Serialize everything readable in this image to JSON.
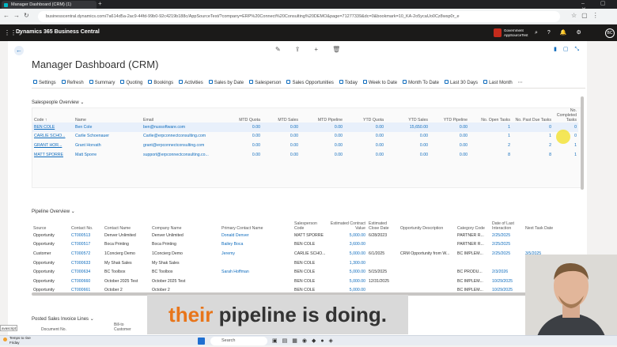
{
  "browser": {
    "tab_title": "Manager Dashboard (CRM) (1)",
    "url": "businesscentral.dynamics.com/7a614d5a-2ac9-44fd-99b0-92c4219b188c/AppSourceTest/?company=ERP%20Connect%20Consulting%20DEMO&page=71277339&dc=0&bookmark=10_KA-2o5ycaUo0Cz8wsp0r_e"
  },
  "app": {
    "title": "Dynamics 365 Business Central",
    "env_badge": "Government AppSourceTest",
    "avatar": "BC",
    "page_title": "Manager Dashboard (CRM)"
  },
  "commands": [
    "Settings",
    "Refresh",
    "Summary",
    "Quoting",
    "Bookings",
    "Activities",
    "Sales by Date",
    "Salesperson",
    "Sales Opportunities",
    "Today",
    "Week to Date",
    "Month To Date",
    "Last 30 Days",
    "Last Month"
  ],
  "salespeople": {
    "title": "Salespeople Overview",
    "columns": [
      "Code ↑",
      "Name",
      "Email",
      "MTD Quota",
      "MTD Sales",
      "MTD Pipeline",
      "YTD Quota",
      "YTD Sales",
      "YTD Pipeline",
      "No. Open Tasks",
      "No. Past Due Tasks",
      "No. Completed Tasks"
    ],
    "rows": [
      [
        "BEN COLE",
        "Ben Cole",
        "ben@nuxsoftware.com",
        "0.00",
        "0.00",
        "0.00",
        "0.00",
        "15,650.00",
        "0.00",
        "1",
        "0",
        "0"
      ],
      [
        "CARLIE SCHO...",
        "Carlie Schoenauer",
        "Carlie@erpconnectconsulting.com",
        "0.00",
        "0.00",
        "0.00",
        "0.00",
        "0.00",
        "0.00",
        "1",
        "1",
        "0"
      ],
      [
        "GRANT HOR...",
        "Grant Horvath",
        "grant@erpconnectconsulting.com",
        "0.00",
        "0.00",
        "0.00",
        "0.00",
        "0.00",
        "0.00",
        "2",
        "2",
        "1"
      ],
      [
        "MATT SPORRE",
        "Matt Sporre",
        "support@erpconnectconsulting.co...",
        "0.00",
        "0.00",
        "0.00",
        "0.00",
        "0.00",
        "0.00",
        "8",
        "8",
        "1"
      ]
    ]
  },
  "pipeline": {
    "title": "Pipeline Overview",
    "columns": [
      "Source",
      "Contact No.",
      "Contact Name",
      "Company Name",
      "Primary Contact Name",
      "Salesperson Code",
      "Estimated Contract Value",
      "Estimated Close Date",
      "Opportunity Description",
      "Category Code",
      "Date of Last Interaction",
      "Next Task Date"
    ],
    "rows": [
      [
        "Opportunity",
        "CT000513",
        "Denver Unlimited",
        "Denver Unlimited",
        "Donald Denver",
        "MATT SPORRE",
        "5,000.00",
        "6/28/2023",
        "",
        "PARTNER R...",
        "2/25/2025",
        ""
      ],
      [
        "Opportunity",
        "CT000517",
        "Boca Printing",
        "Boca Printing",
        "Bailey Boca",
        "BEN COLE",
        "3,600.00",
        "",
        "",
        "PARTNER R...",
        "2/25/2025",
        ""
      ],
      [
        "Customer",
        "CT000572",
        "1Concierg Demo",
        "1Concierg Demo",
        "Jeremy",
        "CARLIE SCHO...",
        "5,000.00",
        "6/1/2025",
        "CRM Opportunity from W...",
        "BC IMPLEM...",
        "2/25/2025",
        "3/5/2025"
      ],
      [
        "Opportunity",
        "CT000633",
        "My Shak Sales",
        "My Shak Sales",
        "",
        "BEN COLE",
        "1,300.00",
        "",
        "",
        "",
        "",
        ""
      ],
      [
        "Opportunity",
        "CT000634",
        "BC Toolbox",
        "BC Toolbox",
        "Sarah Hoffman",
        "BEN COLE",
        "5,000.00",
        "5/15/2025",
        "",
        "BC PRODU...",
        "2/3/2026",
        ""
      ],
      [
        "Opportunity",
        "CT000660",
        "October 2025 Test",
        "October 2025 Test",
        "",
        "BEN COLE",
        "5,000.00",
        "12/31/2025",
        "",
        "BC IMPLEM...",
        "10/29/2025",
        ""
      ],
      [
        "Opportunity",
        "CT000661",
        "October 2",
        "October 2",
        "",
        "BEN COLE",
        "5,000.00",
        "",
        "",
        "BC IMPLEM...",
        "10/29/2025",
        ""
      ]
    ]
  },
  "invoice": {
    "title": "Posted Sales Invoice Lines",
    "col1": "Document No.",
    "col2": "Bill-to Customer"
  },
  "caption": {
    "highlight": "their",
    "rest": " pipeline is doing."
  },
  "taskbar": {
    "weather": "Temps to rise",
    "day": "Friday",
    "search": "Search",
    "left_tip": "avascript:"
  }
}
